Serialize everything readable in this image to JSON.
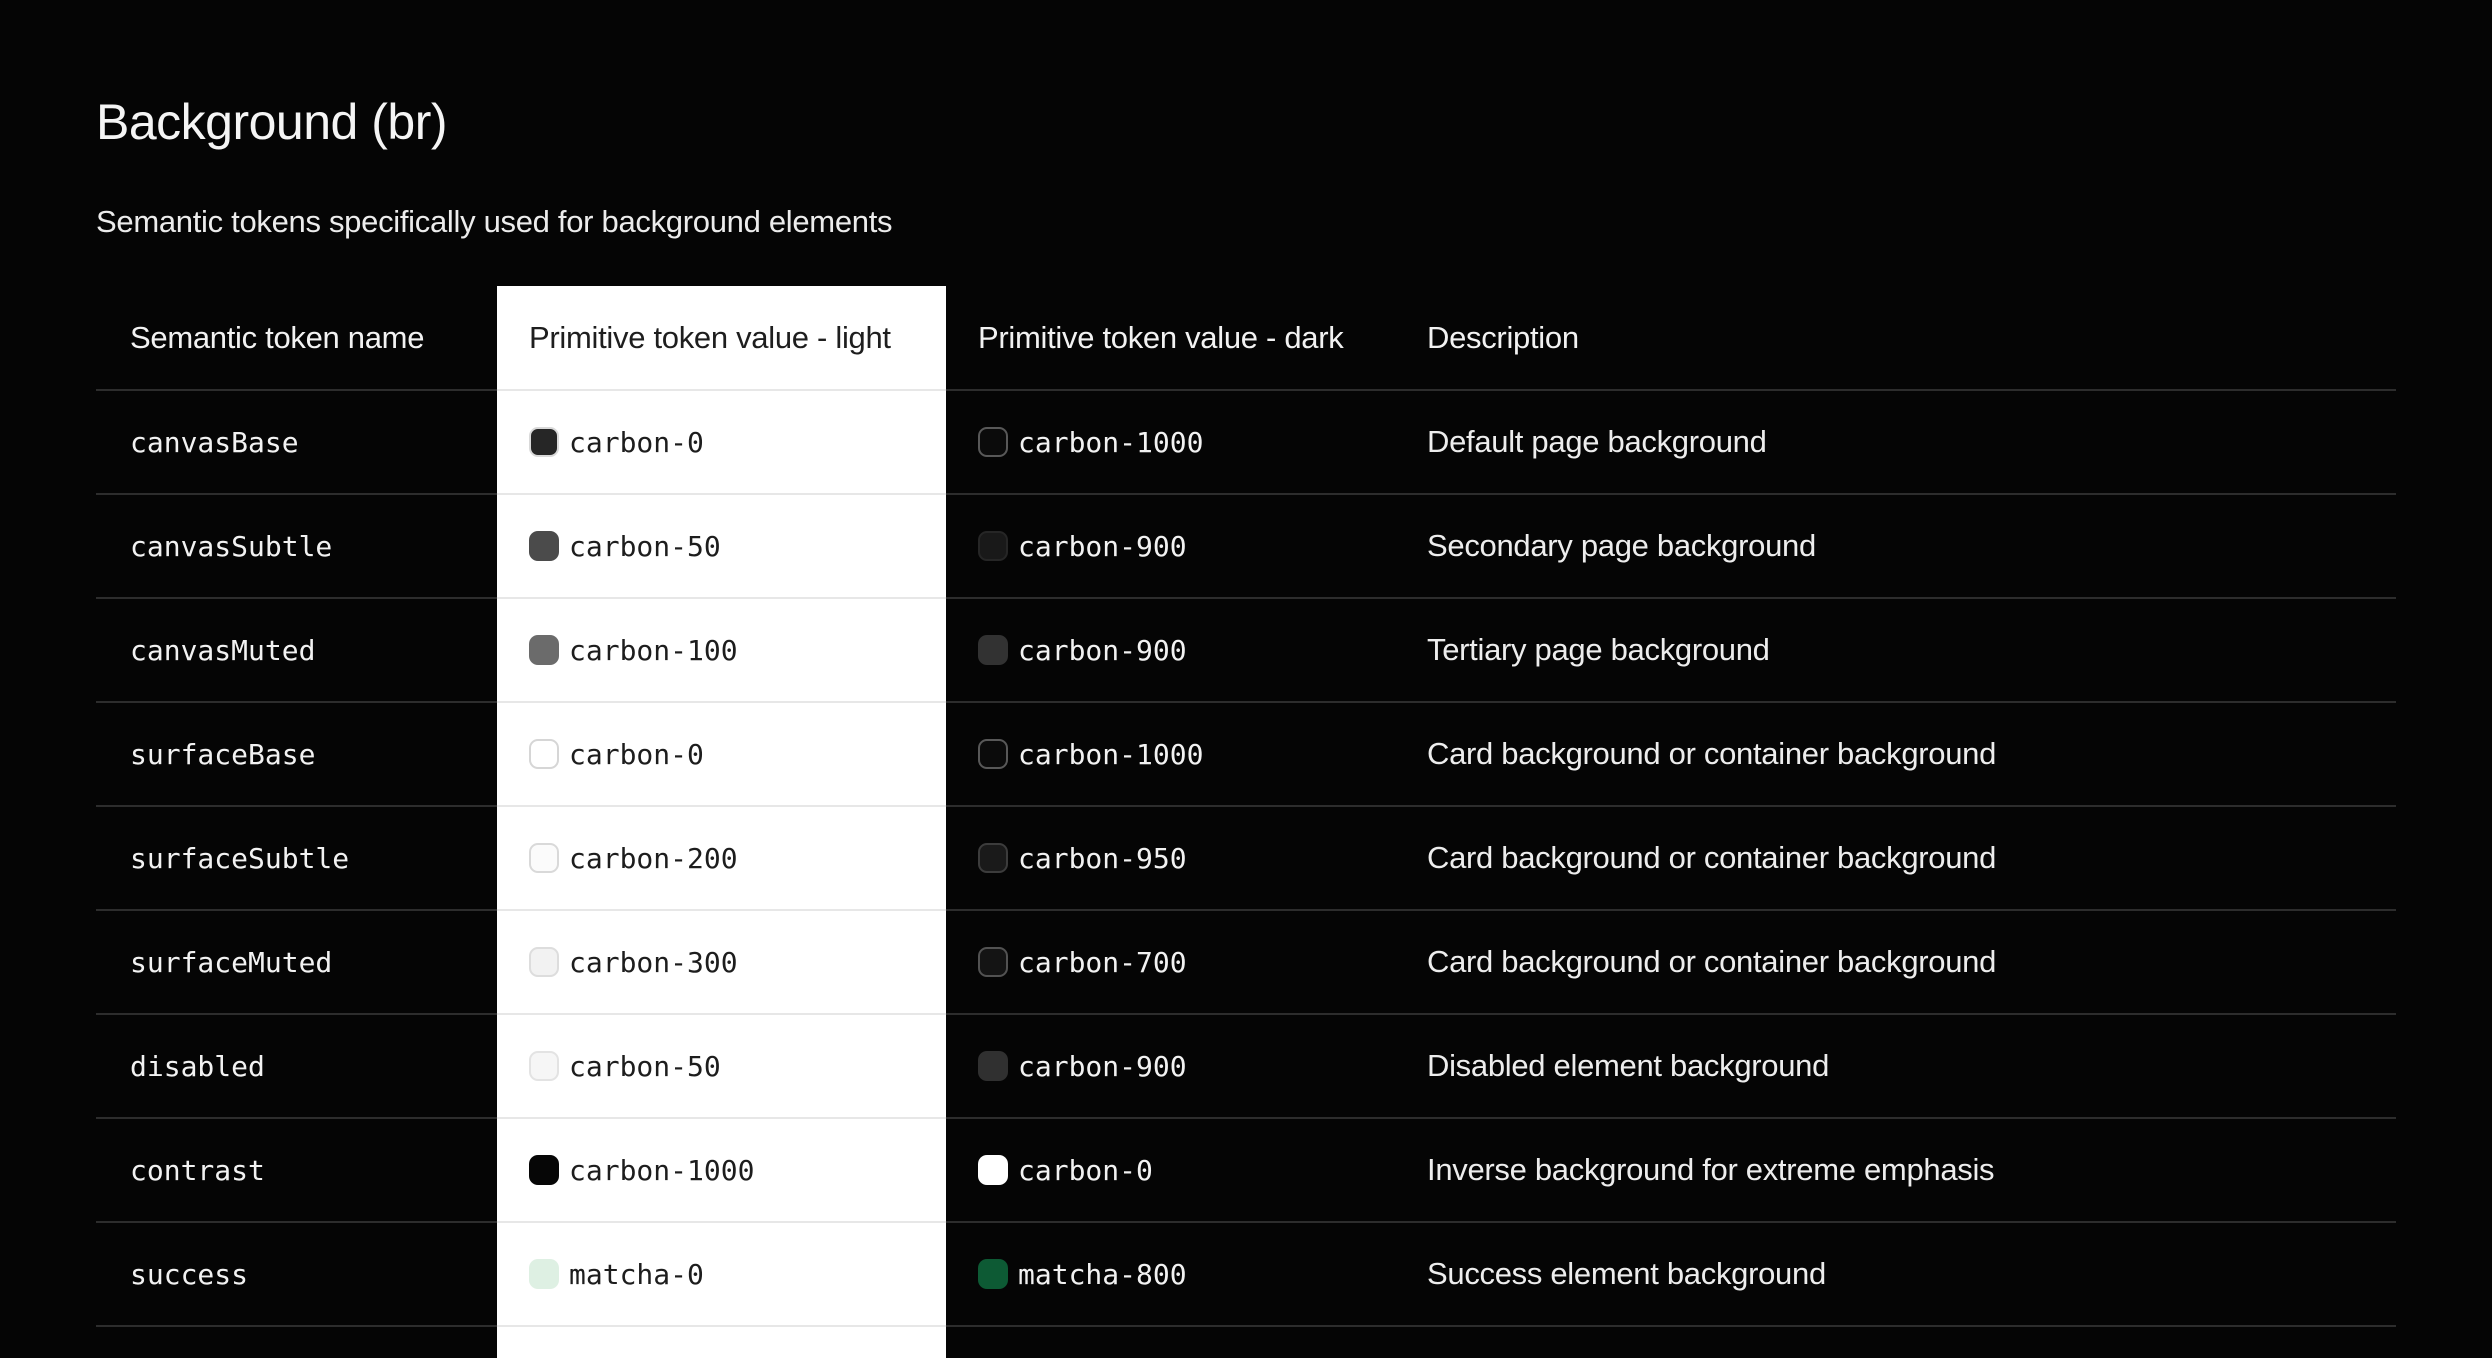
{
  "page": {
    "title": "Background (br)",
    "subtitle": "Semantic tokens specifically used for background elements"
  },
  "colors": {
    "page_bg": "#050505",
    "light_column_bg": "#ffffff",
    "divider_dark": "#2d2d2d",
    "divider_light": "#e7e7e7"
  },
  "table": {
    "headers": {
      "name": "Semantic token name",
      "light": "Primitive token value - light",
      "dark": "Primitive token value - dark",
      "description": "Description"
    },
    "rows": [
      {
        "name": "canvasBase",
        "light": {
          "label": "carbon-0",
          "swatch_hex": "#262626",
          "swatch_css": "background:#262626;border:2px solid #d9d9d9"
        },
        "dark": {
          "label": "carbon-1000",
          "swatch_hex": "#0b0b0b",
          "swatch_css": "background:#0b0b0b;border:2px solid #585858"
        },
        "description": "Default page background"
      },
      {
        "name": "canvasSubtle",
        "light": {
          "label": "carbon-50",
          "swatch_hex": "#4b4b4b",
          "swatch_css": "background:#4b4b4b"
        },
        "dark": {
          "label": "carbon-900",
          "swatch_hex": "#191919",
          "swatch_css": "background:#191919;border:2px solid #262626"
        },
        "description": "Secondary page background"
      },
      {
        "name": "canvasMuted",
        "light": {
          "label": "carbon-100",
          "swatch_hex": "#6b6b6b",
          "swatch_css": "background:#6b6b6b"
        },
        "dark": {
          "label": "carbon-900",
          "swatch_hex": "#323232",
          "swatch_css": "background:#323232"
        },
        "description": "Tertiary page background"
      },
      {
        "name": "surfaceBase",
        "light": {
          "label": "carbon-0",
          "swatch_hex": "#ffffff",
          "swatch_css": "background:#ffffff;border:2px solid #d6d6d6"
        },
        "dark": {
          "label": "carbon-1000",
          "swatch_hex": "#0b0b0b",
          "swatch_css": "background:#0b0b0b;border:2px solid #585858"
        },
        "description": "Card background or container background"
      },
      {
        "name": "surfaceSubtle",
        "light": {
          "label": "carbon-200",
          "swatch_hex": "#fbfbfb",
          "swatch_css": "background:#fbfbfb;border:2px solid #d9d9d9"
        },
        "dark": {
          "label": "carbon-950",
          "swatch_hex": "#1a1a1a",
          "swatch_css": "background:#1a1a1a;border:2px solid #3c3c3c"
        },
        "description": "Card background or container background"
      },
      {
        "name": "surfaceMuted",
        "light": {
          "label": "carbon-300",
          "swatch_hex": "#f2f2f2",
          "swatch_css": "background:#f2f2f2;border:2px solid #dddddd"
        },
        "dark": {
          "label": "carbon-700",
          "swatch_hex": "#141414",
          "swatch_css": "background:#141414;border:2px solid #525252"
        },
        "description": "Card background or container background"
      },
      {
        "name": "disabled",
        "light": {
          "label": "carbon-50",
          "swatch_hex": "#f6f6f6",
          "swatch_css": "background:#f6f6f6;border:2px solid #e3e3e3"
        },
        "dark": {
          "label": "carbon-900",
          "swatch_hex": "#303030",
          "swatch_css": "background:#303030"
        },
        "description": "Disabled element background"
      },
      {
        "name": "contrast",
        "light": {
          "label": "carbon-1000",
          "swatch_hex": "#060606",
          "swatch_css": "background:#060606"
        },
        "dark": {
          "label": "carbon-0",
          "swatch_hex": "#ffffff",
          "swatch_css": "background:#ffffff"
        },
        "description": "Inverse background for extreme emphasis"
      },
      {
        "name": "success",
        "light": {
          "label": "matcha-0",
          "swatch_hex": "#def0e3",
          "swatch_css": "background:#def0e3"
        },
        "dark": {
          "label": "matcha-800",
          "swatch_hex": "#0d5a34",
          "swatch_css": "background:#0d5a34"
        },
        "description": "Success element background"
      }
    ]
  }
}
